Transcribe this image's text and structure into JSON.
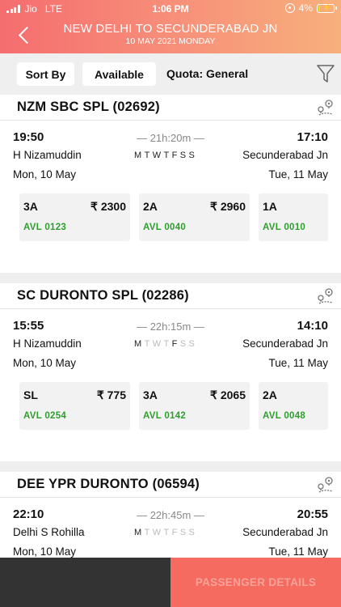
{
  "status_bar": {
    "carrier": "Jio",
    "network": "LTE",
    "time": "1:06 PM",
    "battery": "4%"
  },
  "header": {
    "title": "NEW DELHI TO SECUNDERABAD JN",
    "date": "10 MAY 2021 MONDAY"
  },
  "filters": {
    "sort_by": "Sort By",
    "available": "Available",
    "quota": "Quota: General"
  },
  "trains": [
    {
      "name": "NZM SBC SPL (02692)",
      "dep_time": "19:50",
      "dep_station": "H Nizamuddin",
      "dep_date": "Mon, 10 May",
      "arr_time": "17:10",
      "arr_station": "Secunderabad Jn",
      "arr_date": "Tue, 11 May",
      "duration": "— 21h:20m —",
      "days": [
        "M",
        "T",
        "W",
        "T",
        "F",
        "S",
        "S"
      ],
      "days_running": [
        true,
        true,
        true,
        true,
        true,
        true,
        true
      ],
      "classes": [
        {
          "name": "3A",
          "fare": "₹ 2300",
          "avl": "AVL 0123"
        },
        {
          "name": "2A",
          "fare": "₹ 2960",
          "avl": "AVL 0040"
        },
        {
          "name": "1A",
          "fare": "",
          "avl": "AVL 0010"
        }
      ]
    },
    {
      "name": "SC DURONTO SPL (02286)",
      "dep_time": "15:55",
      "dep_station": "H Nizamuddin",
      "dep_date": "Mon, 10 May",
      "arr_time": "14:10",
      "arr_station": "Secunderabad Jn",
      "arr_date": "Tue, 11 May",
      "duration": "— 22h:15m —",
      "days": [
        "M",
        "T",
        "W",
        "T",
        "F",
        "S",
        "S"
      ],
      "days_running": [
        true,
        false,
        false,
        false,
        true,
        false,
        false
      ],
      "classes": [
        {
          "name": "SL",
          "fare": "₹ 775",
          "avl": "AVL 0254"
        },
        {
          "name": "3A",
          "fare": "₹ 2065",
          "avl": "AVL 0142"
        },
        {
          "name": "2A",
          "fare": "",
          "avl": "AVL 0048"
        }
      ]
    },
    {
      "name": "DEE YPR DURONTO (06594)",
      "dep_time": "22:10",
      "dep_station": "Delhi S Rohilla",
      "dep_date": "Mon, 10 May",
      "arr_time": "20:55",
      "arr_station": "Secunderabad Jn",
      "arr_date": "Tue, 11 May",
      "duration": "— 22h:45m —",
      "days": [
        "M",
        "T",
        "W",
        "T",
        "F",
        "S",
        "S"
      ],
      "days_running": [
        true,
        false,
        false,
        false,
        false,
        false,
        false
      ],
      "classes": []
    }
  ],
  "footer": {
    "passenger_details": "PASSENGER DETAILS"
  },
  "colors": {
    "header_start": "#f56d6f",
    "header_end": "#f7b07c",
    "avl_green": "#2f9e2f",
    "button": "#f56b5f"
  },
  "icons": {
    "back": "chevron-left-icon",
    "filter": "funnel-icon",
    "route": "route-map-icon"
  }
}
